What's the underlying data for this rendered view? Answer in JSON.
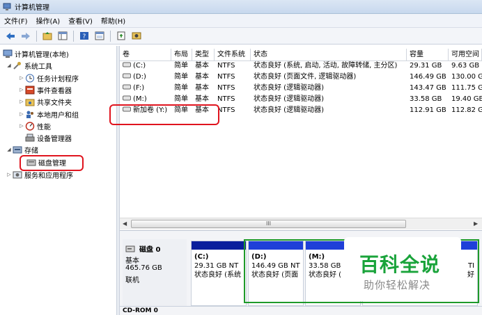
{
  "window": {
    "title": "计算机管理"
  },
  "menu": [
    "文件(F)",
    "操作(A)",
    "查看(V)",
    "帮助(H)"
  ],
  "toolbar_icons": [
    "back-arrow-icon",
    "forward-arrow-icon",
    "up-folder-icon",
    "show-tree-icon",
    "help-icon",
    "properties-icon",
    "export-icon",
    "settings-icon"
  ],
  "tree": {
    "root": "计算机管理(本地)",
    "system_tools": "系统工具",
    "task_scheduler": "任务计划程序",
    "event_viewer": "事件查看器",
    "shared_folders": "共享文件夹",
    "local_users": "本地用户和组",
    "performance": "性能",
    "device_manager": "设备管理器",
    "storage": "存储",
    "disk_management": "磁盘管理",
    "services_apps": "服务和应用程序"
  },
  "columns": [
    "卷",
    "布局",
    "类型",
    "文件系统",
    "状态",
    "容量",
    "可用空间"
  ],
  "volumes": [
    {
      "vol": "(C:)",
      "layout": "简单",
      "type": "基本",
      "fs": "NTFS",
      "status": "状态良好 (系统, 启动, 活动, 故障转储, 主分区)",
      "capacity": "29.31 GB",
      "free": "9.63 GB"
    },
    {
      "vol": "(D:)",
      "layout": "简单",
      "type": "基本",
      "fs": "NTFS",
      "status": "状态良好 (页面文件, 逻辑驱动器)",
      "capacity": "146.49 GB",
      "free": "130.00 G"
    },
    {
      "vol": "(F:)",
      "layout": "简单",
      "type": "基本",
      "fs": "NTFS",
      "status": "状态良好 (逻辑驱动器)",
      "capacity": "143.47 GB",
      "free": "111.75 G"
    },
    {
      "vol": "(M:)",
      "layout": "简单",
      "type": "基本",
      "fs": "NTFS",
      "status": "状态良好 (逻辑驱动器)",
      "capacity": "33.58 GB",
      "free": "19.40 GB"
    },
    {
      "vol": "新加卷 (Y:)",
      "layout": "简单",
      "type": "基本",
      "fs": "NTFS",
      "status": "状态良好 (逻辑驱动器)",
      "capacity": "112.91 GB",
      "free": "112.82 G"
    }
  ],
  "scroll_thumb": "III",
  "disk": {
    "name": "磁盘 0",
    "kind": "基本",
    "size": "465.76 GB",
    "state": "联机"
  },
  "partitions": [
    {
      "label": "(C:)",
      "size": "29.31 GB NT",
      "status": "状态良好 (系统"
    },
    {
      "label": "(D:)",
      "size": "146.49 GB NT",
      "status": "状态良好 (页面"
    },
    {
      "label": "(M:)",
      "size": "33.58 GB",
      "status": "状态良好 ("
    },
    {
      "label": "",
      "size": "TI",
      "status": "好"
    }
  ],
  "cdrom": {
    "name": "CD-ROM 0"
  },
  "watermark": {
    "main": "百科全说",
    "sub": "助你轻松解决"
  },
  "colors": {
    "highlight_red": "#e0141e",
    "partition_green": "#1e9a2a",
    "primary_bar": "#0a1f9c",
    "logical_bar": "#1f3fd8",
    "brand_green": "#19a33a"
  }
}
